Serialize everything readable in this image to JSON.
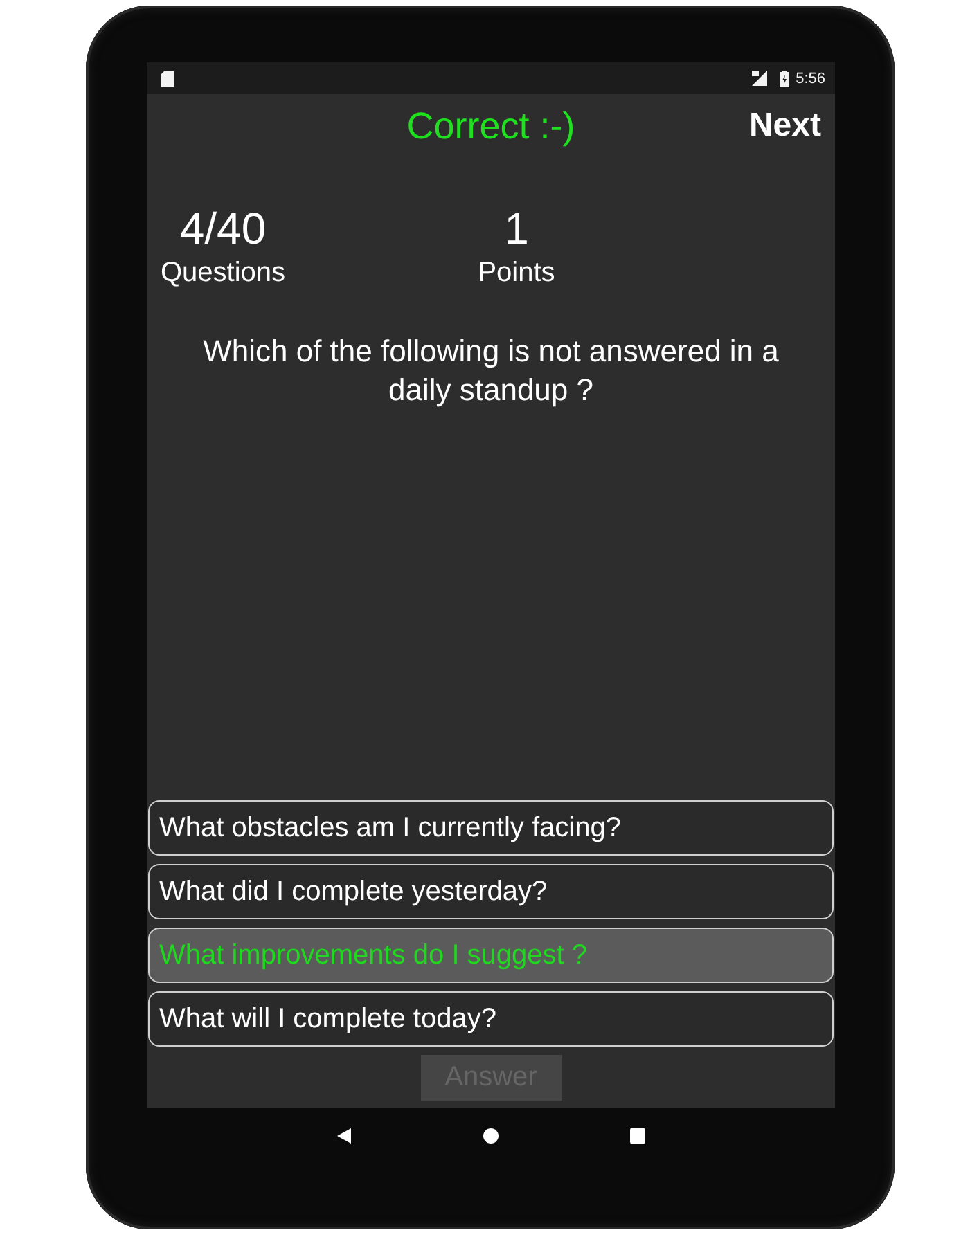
{
  "status_bar": {
    "time": "5:56"
  },
  "header": {
    "title": "Correct :-)",
    "next_button": "Next"
  },
  "stats": [
    {
      "value": "4/40",
      "label": "Questions"
    },
    {
      "value": "1",
      "label": "Points"
    }
  ],
  "question": "Which of the following is not answered in a daily standup ?",
  "options": [
    {
      "text": "What obstacles am I currently facing?",
      "selected": false,
      "correct": false
    },
    {
      "text": "What did I complete yesterday?",
      "selected": false,
      "correct": false
    },
    {
      "text": "What improvements do I suggest ?",
      "selected": true,
      "correct": true
    },
    {
      "text": "What will I complete today?",
      "selected": false,
      "correct": false
    }
  ],
  "answer_button": {
    "label": "Answer",
    "disabled": true
  }
}
